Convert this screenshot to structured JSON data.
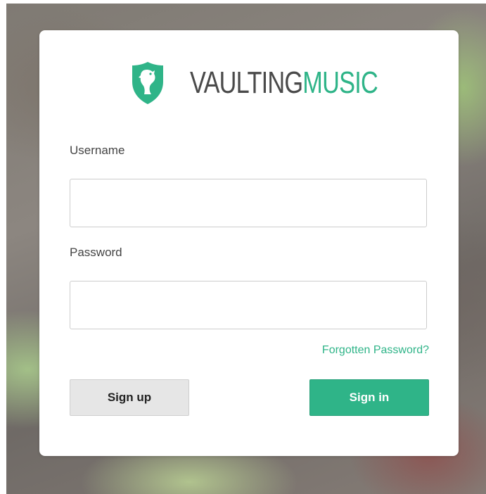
{
  "brand": {
    "name_part1": "VAULTING",
    "name_part2": "MUSIC",
    "logo_icon": "shield-horse-icon",
    "accent_color": "#2fb488"
  },
  "form": {
    "username_label": "Username",
    "username_value": "",
    "password_label": "Password",
    "password_value": "",
    "forgot_link": "Forgotten Password?",
    "signup_label": "Sign up",
    "signin_label": "Sign in"
  }
}
